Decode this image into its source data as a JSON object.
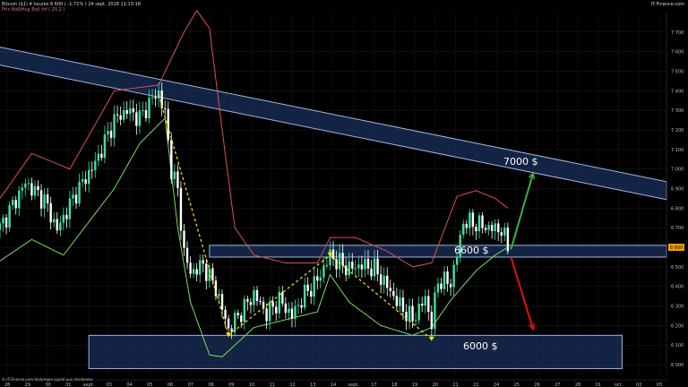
{
  "header": {
    "line1": "Bitcoin ($1)   4 heures   6 600 ( -1,71% )   24 sept. 2018 11:15:18",
    "line2": "Prix  BolliHup  Boll Inf ( 20,2 )",
    "brand": "IT-Finance.com"
  },
  "footer": {
    "credit": "© IT-Finance.com Historique ajusté aux dividendes"
  },
  "colors": {
    "bull": "#3fe0a0",
    "bear": "#ffffff",
    "upper_band": "#d9534f",
    "lower_band": "#7ddc5a",
    "zone_fill": "#1a2f5a",
    "zone_stroke": "#9fb6e6",
    "arrow_up": "#3cb043",
    "arrow_down": "#e01010",
    "trend_dash": "#f2e200",
    "price_badge": "#f5a000"
  },
  "chart_data": {
    "type": "candlestick",
    "title": "Bitcoin ($1)",
    "timeframe": "4 heures",
    "last_price": 6600,
    "change_pct": -1.71,
    "y_ticks": [
      6000,
      6100,
      6200,
      6300,
      6400,
      6500,
      6600,
      6700,
      6800,
      6900,
      7000,
      7100,
      7200,
      7300,
      7400,
      7500,
      7600,
      7700
    ],
    "y_tick_labels": [
      "6 000",
      "6 100",
      "6 200",
      "6 300",
      "6 400",
      "6 500",
      "6 600",
      "6 700",
      "6 800",
      "6 900",
      "7 000",
      "7 100",
      "7 200",
      "7 300",
      "7 400",
      "7 500",
      "7 600",
      "7 700"
    ],
    "ylim": [
      5950,
      7800
    ],
    "x_tick_labels": [
      "28",
      "29",
      "30",
      "31",
      "sept.",
      "03",
      "04",
      "05",
      "06",
      "07",
      "08",
      "09",
      "10",
      "11",
      "12",
      "13",
      "14",
      "sept.",
      "17",
      "18",
      "19",
      "20",
      "21",
      "22",
      "24",
      "25",
      "26",
      "27",
      "28",
      "01",
      "oct.",
      "02",
      "03"
    ],
    "x_range": [
      0,
      210
    ],
    "close_anchors": [
      [
        0,
        6700
      ],
      [
        8,
        6930
      ],
      [
        14,
        6840
      ],
      [
        18,
        6690
      ],
      [
        24,
        6880
      ],
      [
        30,
        7030
      ],
      [
        36,
        7250
      ],
      [
        40,
        7300
      ],
      [
        44,
        7260
      ],
      [
        48,
        7360
      ],
      [
        50,
        7390
      ],
      [
        52,
        7280
      ],
      [
        54,
        7000
      ],
      [
        56,
        6890
      ],
      [
        58,
        6570
      ],
      [
        60,
        6470
      ],
      [
        64,
        6510
      ],
      [
        68,
        6390
      ],
      [
        72,
        6180
      ],
      [
        76,
        6270
      ],
      [
        80,
        6360
      ],
      [
        84,
        6260
      ],
      [
        88,
        6330
      ],
      [
        92,
        6250
      ],
      [
        96,
        6360
      ],
      [
        100,
        6430
      ],
      [
        104,
        6560
      ],
      [
        106,
        6530
      ],
      [
        110,
        6490
      ],
      [
        114,
        6510
      ],
      [
        118,
        6490
      ],
      [
        122,
        6400
      ],
      [
        126,
        6300
      ],
      [
        130,
        6230
      ],
      [
        134,
        6340
      ],
      [
        136,
        6210
      ],
      [
        138,
        6430
      ],
      [
        142,
        6420
      ],
      [
        144,
        6560
      ],
      [
        146,
        6730
      ],
      [
        150,
        6720
      ],
      [
        154,
        6700
      ],
      [
        158,
        6690
      ],
      [
        160,
        6600
      ]
    ],
    "upper_band_anchors": [
      [
        0,
        6850
      ],
      [
        10,
        7080
      ],
      [
        22,
        7000
      ],
      [
        36,
        7400
      ],
      [
        50,
        7430
      ],
      [
        58,
        7700
      ],
      [
        62,
        7810
      ],
      [
        66,
        7720
      ],
      [
        70,
        7200
      ],
      [
        74,
        6700
      ],
      [
        80,
        6560
      ],
      [
        90,
        6520
      ],
      [
        100,
        6520
      ],
      [
        104,
        6650
      ],
      [
        112,
        6650
      ],
      [
        122,
        6580
      ],
      [
        130,
        6500
      ],
      [
        136,
        6520
      ],
      [
        144,
        6860
      ],
      [
        150,
        6890
      ],
      [
        156,
        6850
      ],
      [
        160,
        6800
      ]
    ],
    "lower_band_anchors": [
      [
        0,
        6530
      ],
      [
        10,
        6640
      ],
      [
        20,
        6560
      ],
      [
        36,
        6900
      ],
      [
        44,
        7130
      ],
      [
        52,
        7260
      ],
      [
        56,
        6700
      ],
      [
        60,
        6320
      ],
      [
        66,
        6050
      ],
      [
        70,
        6040
      ],
      [
        74,
        6100
      ],
      [
        80,
        6190
      ],
      [
        90,
        6230
      ],
      [
        100,
        6270
      ],
      [
        104,
        6460
      ],
      [
        110,
        6320
      ],
      [
        120,
        6200
      ],
      [
        130,
        6150
      ],
      [
        136,
        6190
      ],
      [
        142,
        6330
      ],
      [
        150,
        6480
      ],
      [
        156,
        6560
      ],
      [
        160,
        6600
      ]
    ],
    "annotations": {
      "resistance_label": "7000 $",
      "mid_support_label": "6600 $",
      "low_support_label": "6000 $"
    },
    "zones": [
      {
        "name": "descending-resistance",
        "from": [
          -10,
          7610
        ],
        "to": [
          210,
          6890
        ]
      },
      {
        "name": "support-6600",
        "price_low": 6550,
        "price_high": 6610,
        "x_from": 66,
        "x_to": 210
      },
      {
        "name": "support-6000",
        "price_low": 5980,
        "price_high": 6150,
        "x_from": 28,
        "x_to": 196
      }
    ],
    "trend_lines": [
      [
        [
          50,
          7380
        ],
        [
          72,
          6150
        ]
      ],
      [
        [
          72,
          6150
        ],
        [
          104,
          6560
        ]
      ],
      [
        [
          104,
          6560
        ],
        [
          136,
          6130
        ]
      ]
    ],
    "scenario_arrows": [
      {
        "direction": "up",
        "from": [
          161,
          6590
        ],
        "to": [
          168,
          6980
        ]
      },
      {
        "direction": "down",
        "from": [
          161,
          6550
        ],
        "to": [
          168,
          6180
        ]
      }
    ]
  }
}
